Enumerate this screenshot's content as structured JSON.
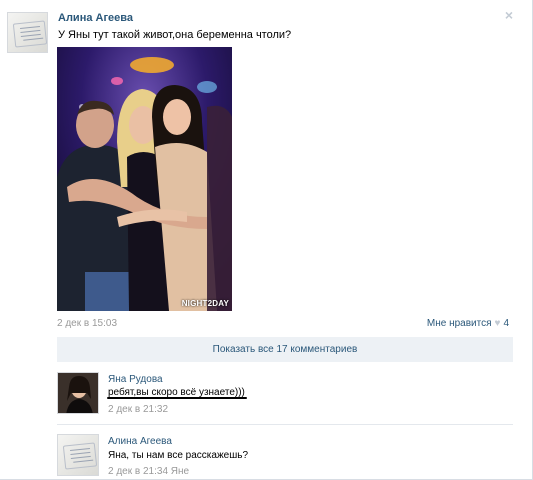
{
  "post": {
    "author": "Алина Агеева",
    "text": "У Яны тут такой живот,она беременна чтоли?",
    "date": "2 дек в 15:03",
    "like_label": "Мне нравится",
    "like_count": "4",
    "photo_watermark": "NIGHT2DAY",
    "close_icon": "×"
  },
  "comments": {
    "show_all_label": "Показать все 17 комментариев",
    "items": [
      {
        "author": "Яна Рудова",
        "text": "ребят,вы скоро всё узнаете)))",
        "date": "2 дек в 21:32"
      },
      {
        "author": "Алина Агеева",
        "text": "Яна, ты нам все расскажешь?",
        "date": "2 дек в 21:34 Яне"
      }
    ]
  },
  "colors": {
    "link": "#2b587a",
    "muted": "#999999",
    "bar": "#edf1f5"
  },
  "icons": {
    "close": "close-icon",
    "like": "heart-icon"
  }
}
